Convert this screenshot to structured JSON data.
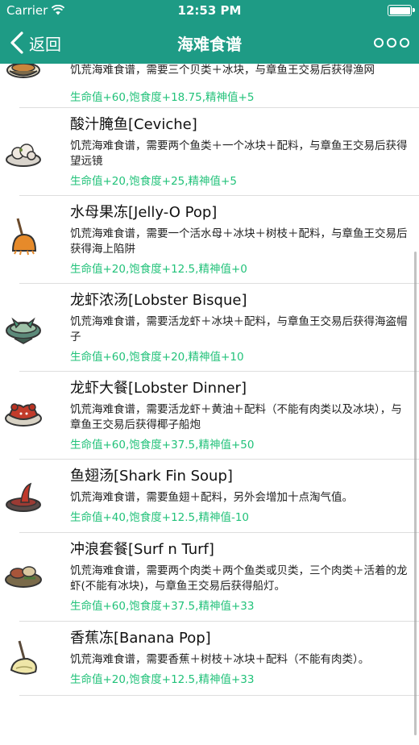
{
  "status": {
    "carrier": "Carrier",
    "time": "12:53 PM"
  },
  "nav": {
    "back_label": "返回",
    "title": "海难食谱"
  },
  "recipes": [
    {
      "name": "",
      "desc": "饥荒海难食谱，需要三个贝类＋冰块，与章鱼王交易后获得渔网",
      "stats": "生命值+60,饱食度+18.75,精神值+5",
      "icon": "bowl-dish-icon"
    },
    {
      "name": "酸汁腌鱼[Ceviche]",
      "desc": "饥荒海难食谱，需要两个鱼类＋一个冰块＋配料，与章鱼王交易后获得望远镜",
      "stats": "生命值+20,饱食度+25,精神值+5",
      "icon": "ceviche-icon"
    },
    {
      "name": "水母果冻[Jelly-O Pop]",
      "desc": "饥荒海难食谱，需要一个活水母＋冰块＋树枝＋配料，与章鱼王交易后获得海上陷阱",
      "stats": "生命值+20,饱食度+12.5,精神值+0",
      "icon": "jelly-pop-icon"
    },
    {
      "name": "龙虾浓汤[Lobster Bisque]",
      "desc": "饥荒海难食谱，需要活龙虾＋冰块＋配料，与章鱼王交易后获得海盗帽子",
      "stats": "生命值+60,饱食度+20,精神值+10",
      "icon": "lobster-bisque-icon"
    },
    {
      "name": "龙虾大餐[Lobster Dinner]",
      "desc": "饥荒海难食谱，需要活龙虾＋黄油＋配料（不能有肉类以及冰块），与章鱼王交易后获得椰子船炮",
      "stats": "生命值+60,饱食度+37.5,精神值+50",
      "icon": "lobster-dinner-icon"
    },
    {
      "name": "鱼翅汤[Shark Fin Soup]",
      "desc": "饥荒海难食谱，需要鱼翅＋配料，另外会增加十点淘气值。",
      "stats": "生命值+40,饱食度+12.5,精神值-10",
      "icon": "shark-fin-soup-icon"
    },
    {
      "name": "冲浪套餐[Surf n Turf]",
      "desc": "饥荒海难食谱，需要两个肉类＋两个鱼类或贝类，三个肉类＋活着的龙虾(不能有冰块)，与章鱼王交易后获得船灯。",
      "stats": "生命值+60,饱食度+37.5,精神值+33",
      "icon": "surf-n-turf-icon"
    },
    {
      "name": "香蕉冻[Banana Pop]",
      "desc": "饥荒海难食谱，需要香蕉＋树枝＋冰块＋配料（不能有肉类）。",
      "stats": "生命值+20,饱食度+12.5,精神值+33",
      "icon": "banana-pop-icon"
    }
  ],
  "colors": {
    "nav_background": "#1e9b85",
    "stats_text": "#22c27a"
  }
}
